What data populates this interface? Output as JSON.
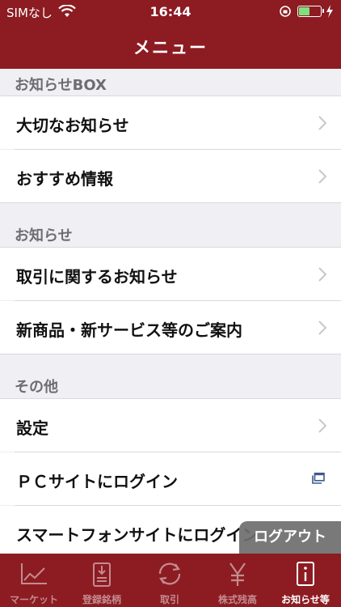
{
  "status_bar": {
    "carrier": "SIMなし",
    "time": "16:44",
    "battery_level": 0.55
  },
  "nav": {
    "title": "メニュー"
  },
  "sections": [
    {
      "header": "お知らせBOX",
      "items": [
        {
          "label": "大切なお知らせ",
          "icon": "chevron-right-icon"
        },
        {
          "label": "おすすめ情報",
          "icon": "chevron-right-icon"
        }
      ]
    },
    {
      "header": "お知らせ",
      "items": [
        {
          "label": "取引に関するお知らせ",
          "icon": "chevron-right-icon"
        },
        {
          "label": "新商品・新サービス等のご案内",
          "icon": "chevron-right-icon"
        }
      ]
    },
    {
      "header": "その他",
      "items": [
        {
          "label": "設定",
          "icon": "chevron-right-icon"
        },
        {
          "label": "ＰＣサイトにログイン",
          "icon": "external-window-icon"
        },
        {
          "label": "スマートフォンサイトにログイン"
        }
      ]
    }
  ],
  "logout_label": "ログアウト",
  "tabs": [
    {
      "label": "マーケット",
      "icon": "chart-icon"
    },
    {
      "label": "登録銘柄",
      "icon": "clipboard-icon"
    },
    {
      "label": "取引",
      "icon": "refresh-icon"
    },
    {
      "label": "株式残高",
      "icon": "yen-icon"
    },
    {
      "label": "お知らせ等",
      "icon": "info-icon",
      "active": true
    }
  ],
  "colors": {
    "brand": "#8c1c22",
    "background": "#efeff4",
    "tab_inactive": "#c48b8f"
  }
}
